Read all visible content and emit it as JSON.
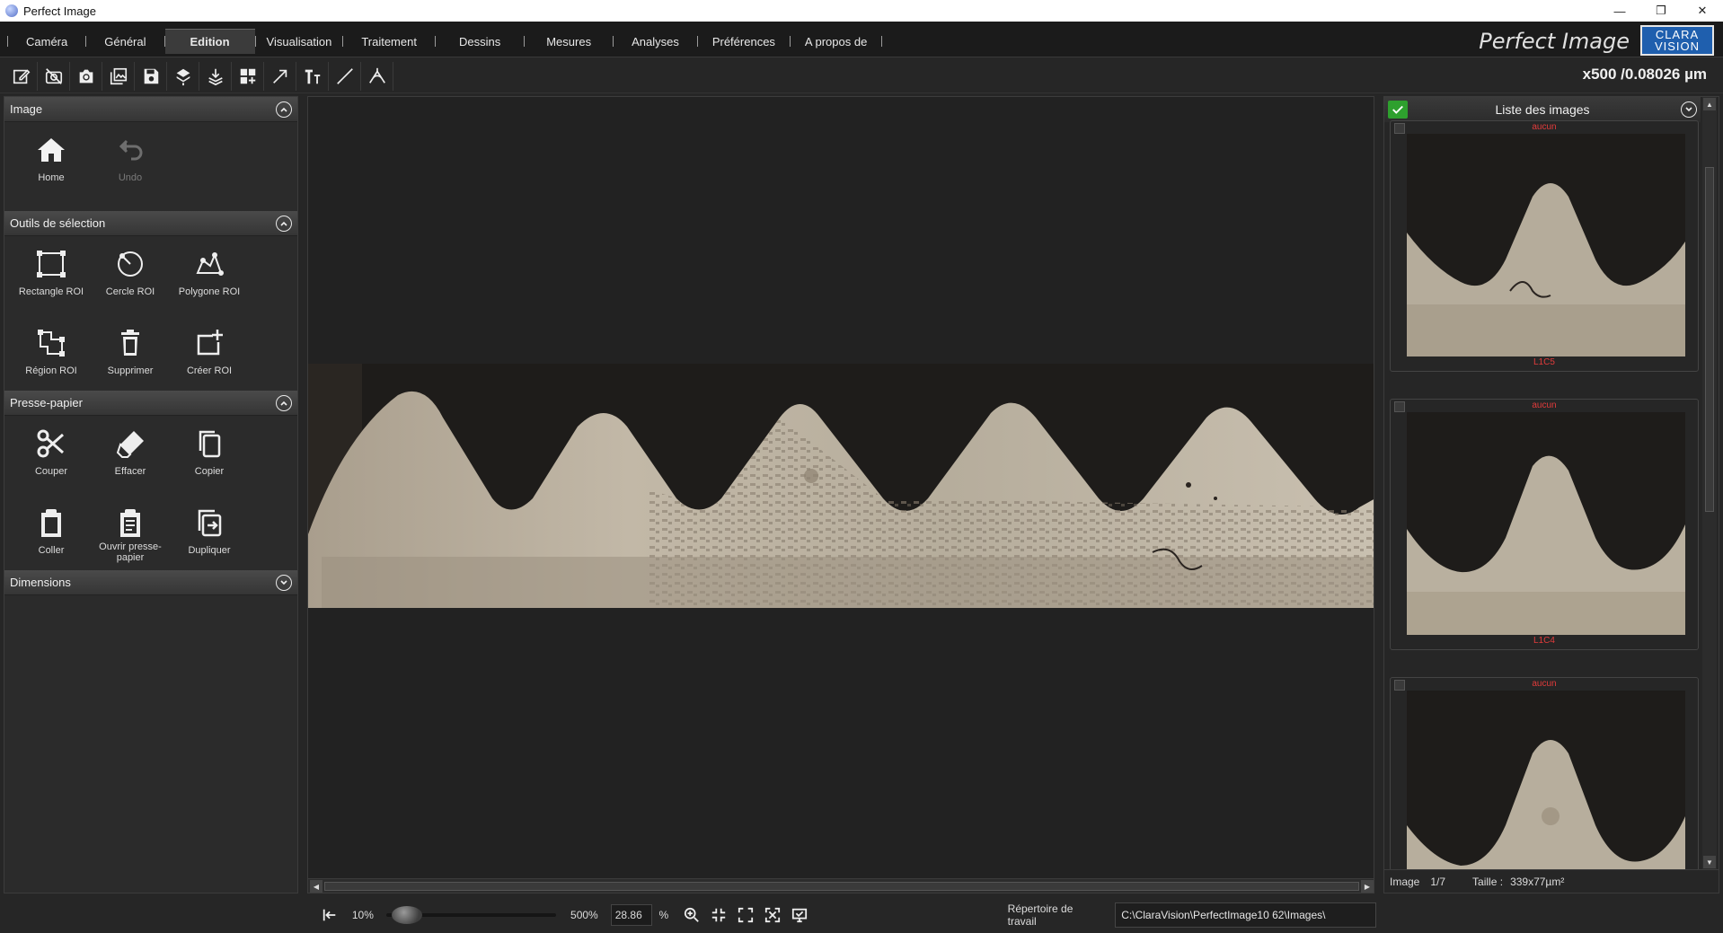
{
  "window": {
    "title": "Perfect Image",
    "controls": [
      "—",
      "❐",
      "✕"
    ]
  },
  "menu": {
    "items": [
      "Caméra",
      "Général",
      "Edition",
      "Visualisation",
      "Traitement",
      "Dessins",
      "Mesures",
      "Analyses",
      "Préférences",
      "A propos de"
    ],
    "active": "Edition",
    "brand": "Perfect Image",
    "logo_line1": "CLARA",
    "logo_line2": "VISION"
  },
  "toolbar": {
    "icons": [
      "edit-icon",
      "no-camera-icon",
      "camera-icon",
      "gallery-icon",
      "save-icon",
      "layers-icon",
      "stack-icon",
      "grid-add-icon",
      "arrow-icon",
      "text-icon",
      "line-icon",
      "angle-icon"
    ],
    "magnification": "x500 /0.08026 µm"
  },
  "left_panel": {
    "sections": {
      "image": {
        "title": "Image",
        "tools": {
          "home": "Home",
          "undo": "Undo"
        }
      },
      "selection": {
        "title": "Outils de sélection",
        "tools": {
          "rect": "Rectangle ROI",
          "circle": "Cercle ROI",
          "polygon": "Polygone ROI",
          "region": "Région ROI",
          "delete": "Supprimer",
          "create": "Créer ROI"
        }
      },
      "clipboard": {
        "title": "Presse-papier",
        "tools": {
          "cut": "Couper",
          "erase": "Effacer",
          "copy": "Copier",
          "paste": "Coller",
          "open_clipboard": "Ouvrir presse-papier",
          "duplicate": "Dupliquer"
        }
      },
      "dimensions": {
        "title": "Dimensions"
      }
    }
  },
  "right_panel": {
    "title": "Liste des images",
    "thumbnails": [
      {
        "top_label": "aucun",
        "bottom_label": "L1C5"
      },
      {
        "top_label": "aucun",
        "bottom_label": "L1C4"
      },
      {
        "top_label": "aucun",
        "bottom_label": ""
      }
    ],
    "footer": {
      "image_label": "Image",
      "image_index": "1/7",
      "size_label": "Taille :",
      "size_value": "339x77µm²"
    }
  },
  "bottom_bar": {
    "zoom_min": "10%",
    "zoom_max": "500%",
    "zoom_value": "28.86",
    "zoom_unit": "%",
    "zoom_level": 0.04,
    "workdir_label": "Répertoire de travail",
    "workdir_path": "C:\\ClaraVision\\PerfectImage10 62\\Images\\"
  },
  "colors": {
    "background": "#262626",
    "menubar": "#1b1b1b",
    "accent_green": "#2ea02e",
    "thumb_label_red": "#e23b3b",
    "logo_blue": "#1f5fae"
  }
}
